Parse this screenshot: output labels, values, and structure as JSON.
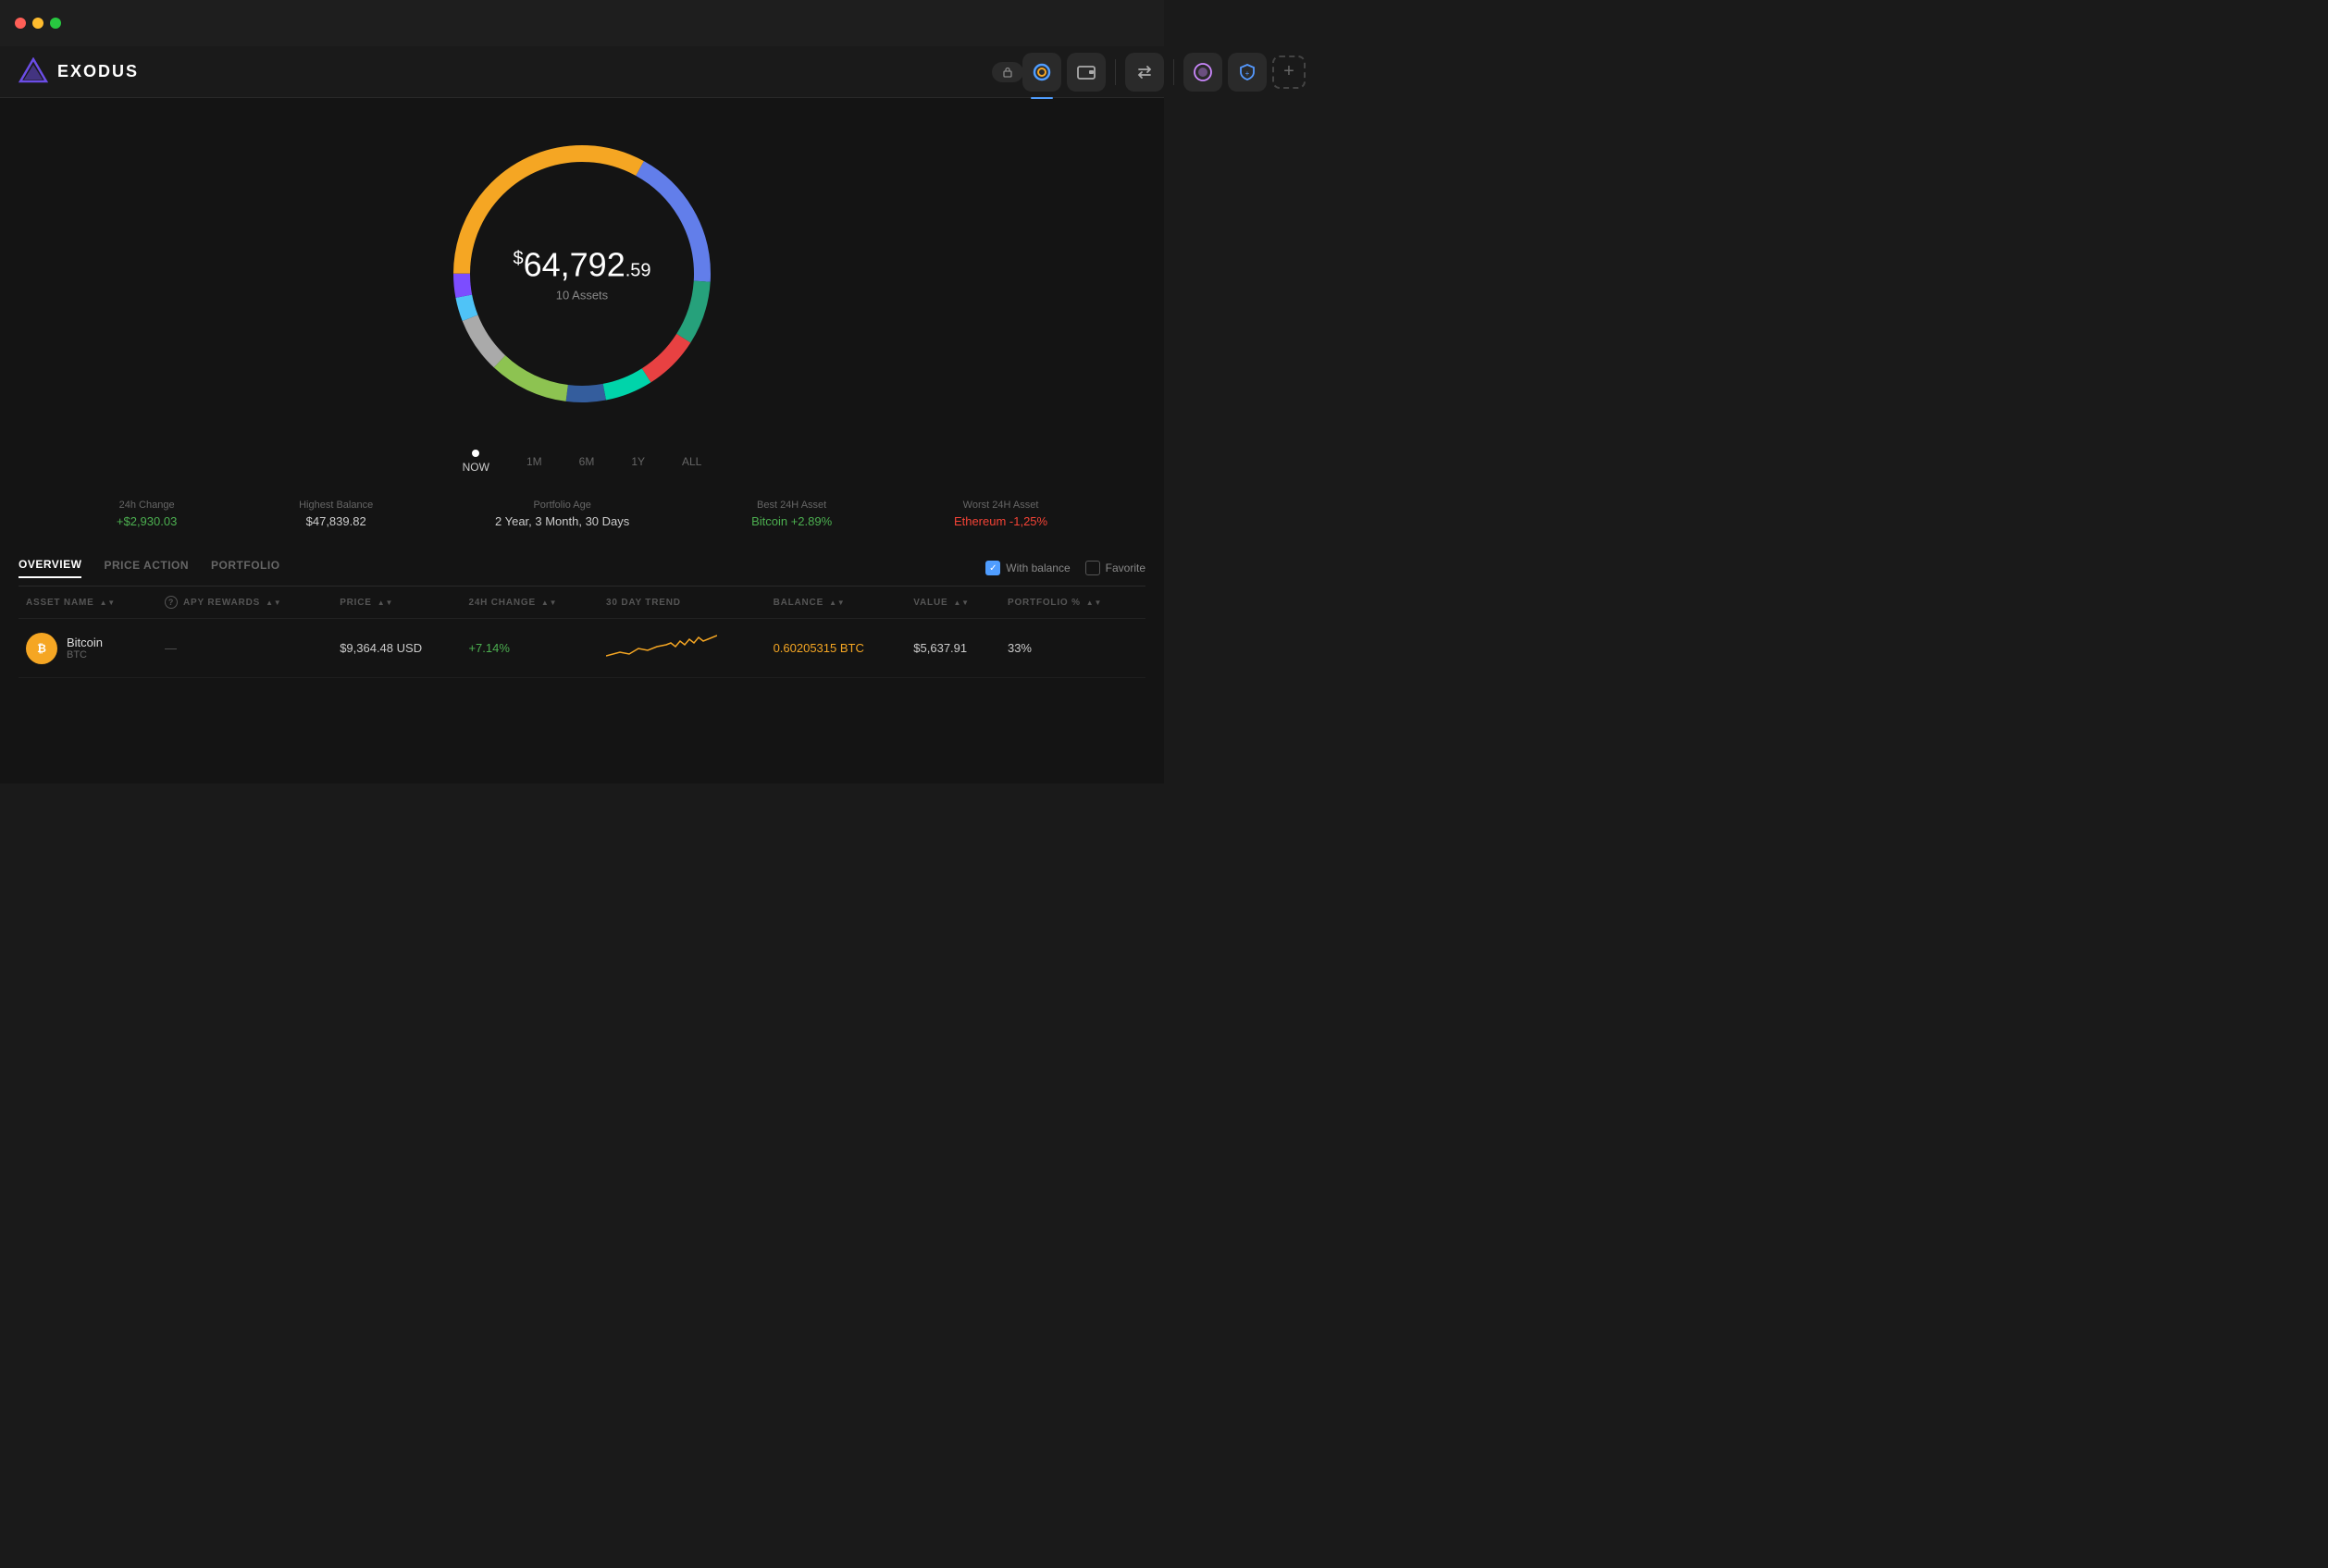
{
  "titlebar": {
    "dots": [
      "red",
      "yellow",
      "green"
    ]
  },
  "header": {
    "logo_text": "EXODUS",
    "nav": [
      {
        "id": "portfolio",
        "icon": "◎",
        "active": true
      },
      {
        "id": "wallet",
        "icon": "▣"
      },
      {
        "id": "exchange",
        "icon": "⇄"
      },
      {
        "id": "nft",
        "icon": "✦"
      },
      {
        "id": "shield",
        "icon": "⬡"
      },
      {
        "id": "add",
        "icon": "+"
      }
    ],
    "right_icons": [
      "lock",
      "history",
      "settings",
      "grid"
    ]
  },
  "portfolio": {
    "amount_prefix": "$",
    "amount_main": "64,792",
    "amount_cents": ".59",
    "assets_count": "10 Assets"
  },
  "timeline": [
    {
      "label": "NOW",
      "active": true
    },
    {
      "label": "1M",
      "active": false
    },
    {
      "label": "6M",
      "active": false
    },
    {
      "label": "1Y",
      "active": false
    },
    {
      "label": "ALL",
      "active": false
    }
  ],
  "stats": [
    {
      "label": "24h Change",
      "value": "+$2,930.03"
    },
    {
      "label": "Highest Balance",
      "value": "$47,839.82"
    },
    {
      "label": "Portfolio Age",
      "value": "2 Year, 3 Month, 30 Days"
    },
    {
      "label": "Best 24H Asset",
      "value": "Bitcoin +2.89%"
    },
    {
      "label": "Worst 24H Asset",
      "value": "Ethereum -1,25%"
    }
  ],
  "table": {
    "tabs": [
      {
        "label": "OVERVIEW",
        "active": true
      },
      {
        "label": "PRICE ACTION",
        "active": false
      },
      {
        "label": "PORTFOLIO",
        "active": false
      }
    ],
    "filters": [
      {
        "label": "With balance",
        "checked": true
      },
      {
        "label": "Favorite",
        "checked": false
      }
    ],
    "columns": [
      {
        "key": "asset_name",
        "label": "ASSET NAME",
        "sortable": true
      },
      {
        "key": "apy",
        "label": "APY REWARDS",
        "sortable": true,
        "has_question": true
      },
      {
        "key": "price",
        "label": "PRICE",
        "sortable": true
      },
      {
        "key": "change_24h",
        "label": "24H CHANGE",
        "sortable": true
      },
      {
        "key": "trend_30d",
        "label": "30 DAY TREND",
        "sortable": false
      },
      {
        "key": "balance",
        "label": "BALANCE",
        "sortable": true
      },
      {
        "key": "value",
        "label": "VALUE",
        "sortable": true
      },
      {
        "key": "portfolio_pct",
        "label": "PORTFOLIO %",
        "sortable": true
      }
    ],
    "rows": [
      {
        "name": "Bitcoin",
        "ticker": "BTC",
        "icon_bg": "#f5a623",
        "icon_char": "₿",
        "apy": "",
        "price": "$9,364.48 USD",
        "change_24h": "+7.14%",
        "change_positive": true,
        "balance": "0.60205315 BTC",
        "balance_color": "#f5a623",
        "value": "$5,637.91",
        "portfolio_pct": "33%"
      }
    ]
  },
  "donut": {
    "segments": [
      {
        "color": "#f5a623",
        "pct": 33,
        "offset": 0
      },
      {
        "color": "#627eea",
        "pct": 18,
        "offset": 33
      },
      {
        "color": "#26a17b",
        "pct": 8,
        "offset": 51
      },
      {
        "color": "#e84142",
        "pct": 7,
        "offset": 59
      },
      {
        "color": "#00d4aa",
        "pct": 6,
        "offset": 66
      },
      {
        "color": "#345d9d",
        "pct": 5,
        "offset": 72
      },
      {
        "color": "#8dc351",
        "pct": 10,
        "offset": 77
      },
      {
        "color": "#aaa",
        "pct": 7,
        "offset": 87
      },
      {
        "color": "#f7931a",
        "pct": 4,
        "offset": 94
      },
      {
        "color": "#2775ca",
        "pct": 3,
        "offset": 98
      }
    ]
  }
}
